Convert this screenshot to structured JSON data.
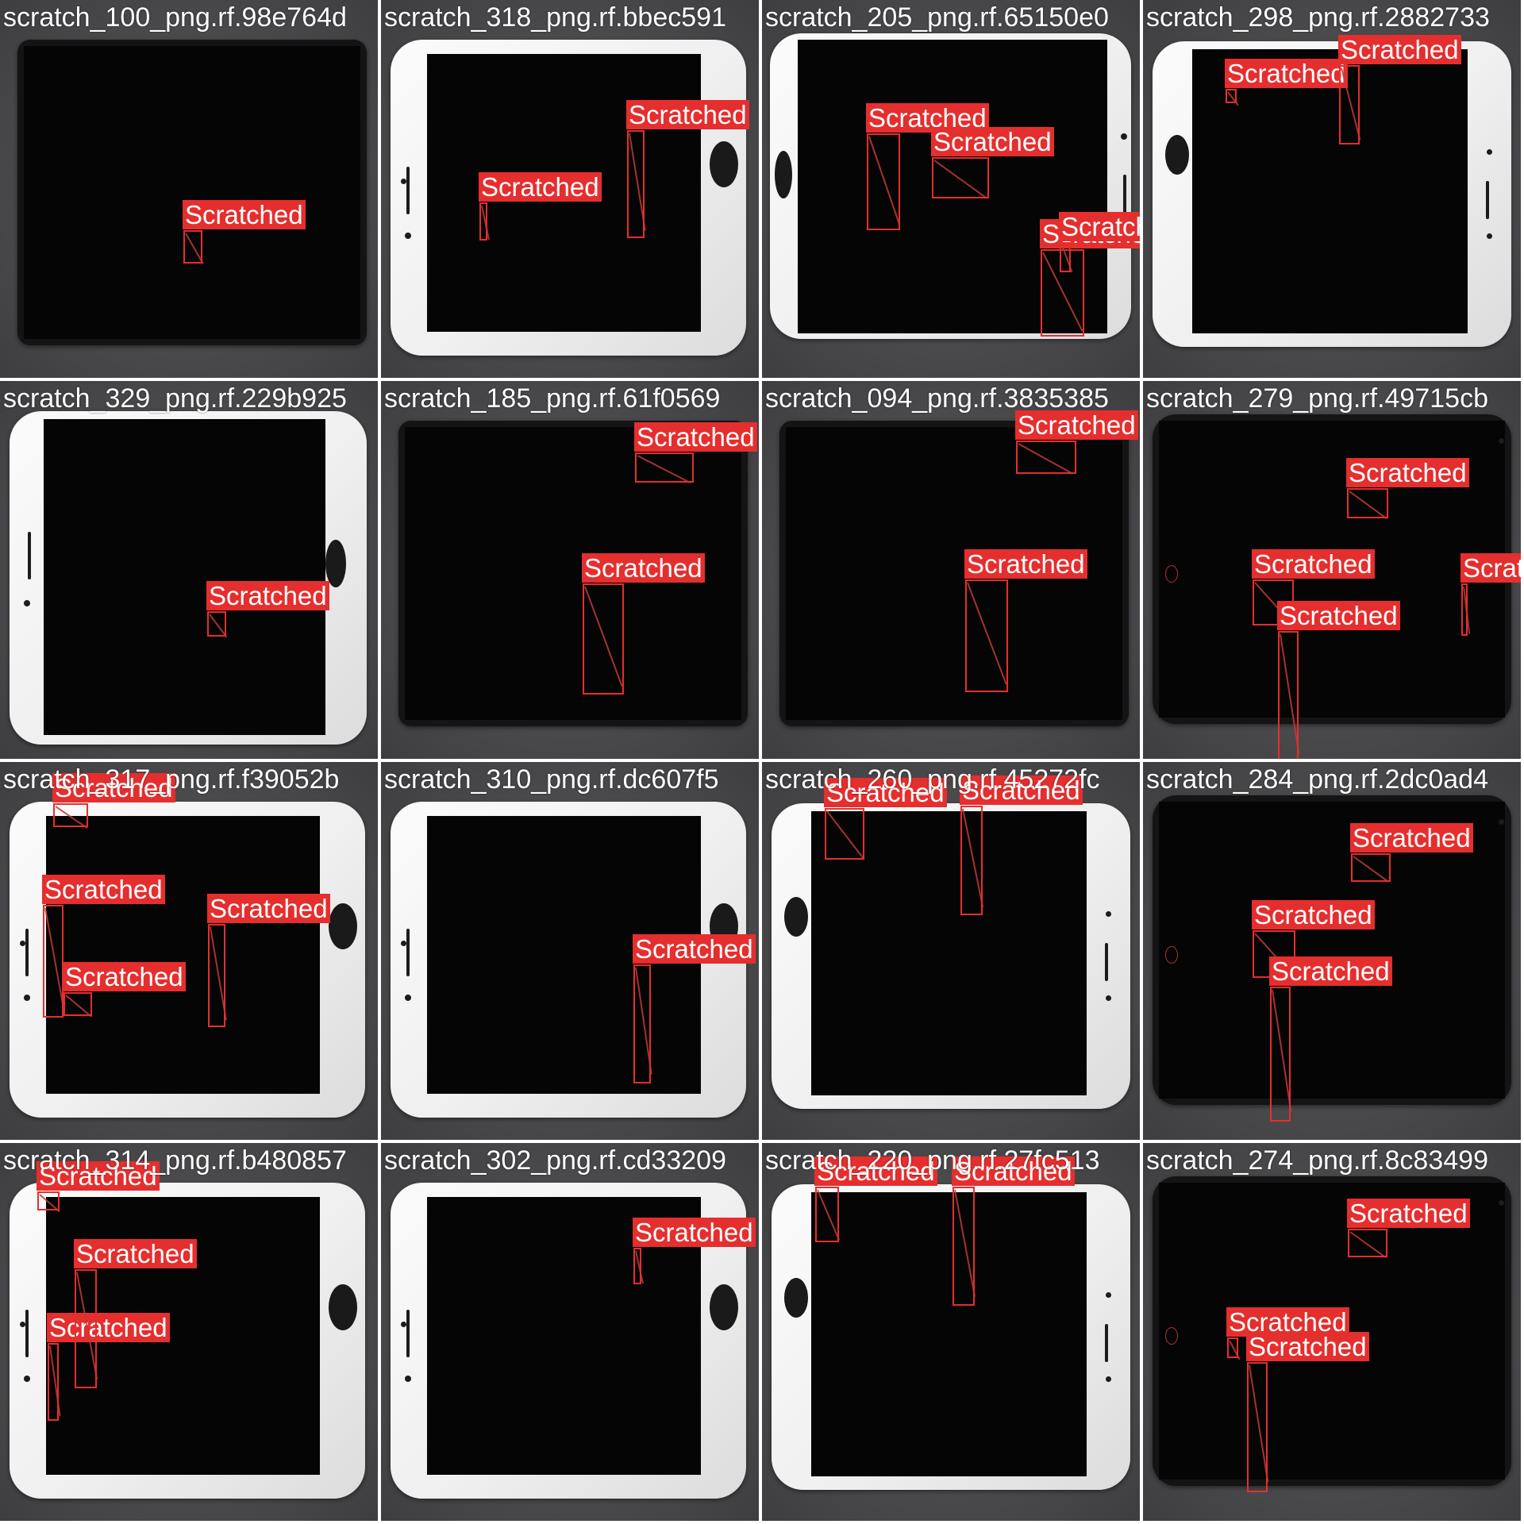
{
  "grid": {
    "rows": [
      [
        "scratch_100_png.rf.98e764d",
        "scratch_318_png.rf.bbec591",
        "scratch_205_png.rf.65150e0",
        "scratch_298_png.rf.2882733"
      ],
      [
        "scratch_329_png.rf.229b925",
        "scratch_185_png.rf.61f0569",
        "scratch_094_png.rf.3835385",
        "scratch_279_png.rf.49715cb"
      ],
      [
        "scratch_317_png.rf.f39052b",
        "scratch_310_png.rf.dc607f5",
        "scratch_260_png.rf.45272fc",
        "scratch_284_png.rf.2dc0ad4"
      ],
      [
        "scratch_314_png.rf.b480857",
        "scratch_302_png.rf.cd33209",
        "scratch_220_png.rf.27fc513",
        "scratch_274_png.rf.8c83499"
      ]
    ]
  },
  "tiles": [
    {
      "name": "scratch_100_png.rf.98e764d",
      "device": "black-flat",
      "labels": [
        "Scratched"
      ]
    },
    {
      "name": "scratch_318_png.rf.bbec591",
      "device": "white-vertical",
      "labels": [
        "Scratched",
        "Scratched"
      ]
    },
    {
      "name": "scratch_205_png.rf.65150e0",
      "device": "white-black-mixed",
      "labels": [
        "Scratched",
        "Scratched",
        "Scratched",
        "Scratched"
      ]
    },
    {
      "name": "scratch_298_png.rf.2882733",
      "device": "white-left",
      "labels": [
        "Scratched",
        "Scratched"
      ]
    },
    {
      "name": "scratch_329_png.rf.229b925",
      "device": "white-home-right",
      "labels": [
        "Scratched"
      ]
    },
    {
      "name": "scratch_185_png.rf.61f0569",
      "device": "black-flat",
      "labels": [
        "Scratched",
        "Scratched"
      ]
    },
    {
      "name": "scratch_094_png.rf.3835385",
      "device": "black-flat",
      "labels": [
        "Scratched",
        "Scratched"
      ]
    },
    {
      "name": "scratch_279_png.rf.49715cb",
      "device": "black-camera",
      "labels": [
        "Scratched",
        "Scratched",
        "Scratched",
        "Scrat"
      ]
    },
    {
      "name": "scratch_317_png.rf.f39052b",
      "device": "white-vertical",
      "labels": [
        "Scratched",
        "Scratched",
        "Scratched",
        "Scratched"
      ]
    },
    {
      "name": "scratch_310_png.rf.dc607f5",
      "device": "white-vertical",
      "labels": [
        "Scratched"
      ]
    },
    {
      "name": "scratch_260_png.rf.45272fc",
      "device": "white-left",
      "labels": [
        "Scratched",
        "Scratched"
      ]
    },
    {
      "name": "scratch_284_png.rf.2dc0ad4",
      "device": "black-camera",
      "labels": [
        "Scratched",
        "Scratched",
        "Scratched"
      ]
    },
    {
      "name": "scratch_314_png.rf.b480857",
      "device": "white-vertical",
      "labels": [
        "Scratched",
        "Scratched",
        "Scratched"
      ]
    },
    {
      "name": "scratch_302_png.rf.cd33209",
      "device": "white-vertical",
      "labels": [
        "Scratched"
      ]
    },
    {
      "name": "scratch_220_png.rf.27fc513",
      "device": "white-left",
      "labels": [
        "Scratched",
        "Scratched"
      ]
    },
    {
      "name": "scratch_274_png.rf.8c83499",
      "device": "black-camera",
      "labels": [
        "Scratched",
        "Scratched",
        "Scratched"
      ]
    }
  ],
  "colors": {
    "box": "#e52e2e",
    "label_text": "#ffffff",
    "filename_text": "#ffffff",
    "background": "#4c4c4e"
  }
}
